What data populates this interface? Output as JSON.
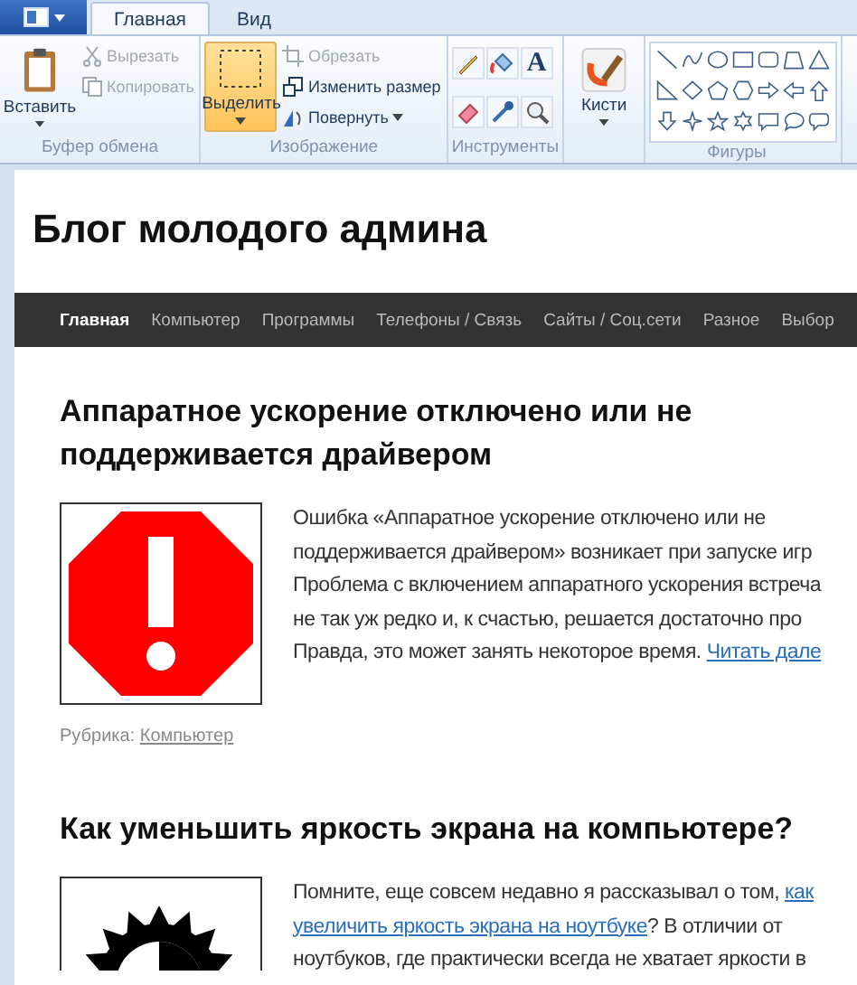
{
  "ribbon": {
    "tabs": [
      {
        "label": "Главная",
        "selected": true
      },
      {
        "label": "Вид",
        "selected": false
      }
    ],
    "groups": [
      {
        "kind": "buttons",
        "label": "Буфер обмена",
        "large": {
          "kind": "paste",
          "label": "Вставить",
          "selected": false
        },
        "small": [
          {
            "kind": "cut",
            "label": "Вырезать",
            "disabled": true
          },
          {
            "kind": "copy",
            "label": "Копировать",
            "disabled": true
          }
        ]
      },
      {
        "kind": "buttons",
        "label": "Изображение",
        "large": {
          "kind": "select",
          "label": "Выделить",
          "selected": true
        },
        "small": [
          {
            "kind": "crop",
            "label": "Обрезать",
            "disabled": true
          },
          {
            "kind": "resize",
            "label": "Изменить размер",
            "disabled": false
          },
          {
            "kind": "rotate",
            "label": "Повернуть",
            "disabled": false
          }
        ]
      },
      {
        "kind": "tools",
        "label": "Инструменты",
        "tools": [
          {
            "kind": "pencil"
          },
          {
            "kind": "fill"
          },
          {
            "kind": "text",
            "glyph": "A"
          },
          {
            "kind": "eraser"
          },
          {
            "kind": "picker"
          },
          {
            "kind": "magnifier"
          }
        ]
      },
      {
        "kind": "single",
        "large": {
          "kind": "brushes",
          "label": "Кисти",
          "selected": false
        }
      },
      {
        "kind": "shapes",
        "label": "Фигуры"
      }
    ]
  },
  "page": {
    "site_title": "Блог молодого админа",
    "nav": [
      {
        "label": "Главная",
        "selected": true
      },
      {
        "label": "Компьютер",
        "selected": false
      },
      {
        "label": "Программы",
        "selected": false
      },
      {
        "label": "Телефоны / Связь",
        "selected": false
      },
      {
        "label": "Сайты / Соц.сети",
        "selected": false
      },
      {
        "label": "Разное",
        "selected": false
      },
      {
        "label": "Выбор",
        "selected": false
      }
    ],
    "posts": [
      {
        "title": "Аппаратное ускорение отключено или не поддерживается драйвером",
        "lines": [
          [
            {
              "text": "Ошибка «Аппаратное ускорение отключено или не"
            }
          ],
          [
            {
              "text": "поддерживается драйвером» возникает при запуске игр"
            }
          ],
          [
            {
              "text": "Проблема с включением аппаратного ускорения встреча"
            }
          ],
          [
            {
              "text": "не так уж редко и, к счастью, решается достаточно про"
            }
          ],
          [
            {
              "text": "Правда, это может занять некоторое время. "
            },
            {
              "text": "Читать дале",
              "link": true
            }
          ]
        ],
        "category_label": "Рубрика:",
        "category": "Компьютер"
      },
      {
        "title": "Как уменьшить яркость экрана на компьютере?",
        "lines": [
          [
            {
              "text": "Помните, еще совсем недавно я рассказывал о том, "
            },
            {
              "text": "как",
              "link": true
            }
          ],
          [
            {
              "text": "увеличить яркость экрана на ноутбуке",
              "link": true
            },
            {
              "text": "? В отличии от"
            }
          ],
          [
            {
              "text": "ноутбуков, где практически всегда не хватает яркости в"
            }
          ]
        ]
      }
    ]
  }
}
